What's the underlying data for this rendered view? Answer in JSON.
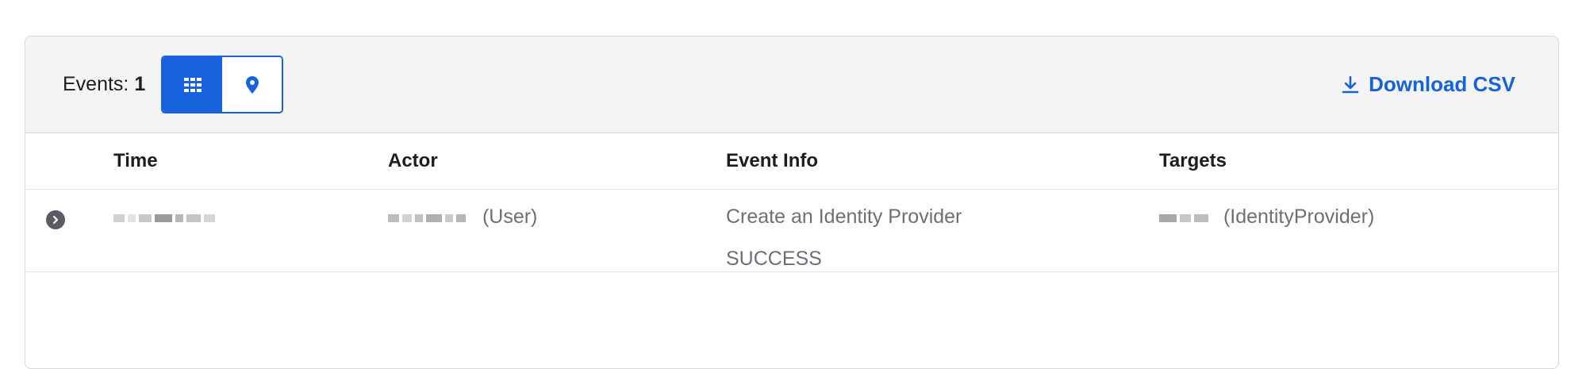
{
  "toolbar": {
    "events_label": "Events:",
    "events_count": "1",
    "view_options": [
      "grid",
      "map"
    ],
    "active_view": "grid",
    "download_label": "Download CSV"
  },
  "table": {
    "columns": [
      "Time",
      "Actor",
      "Event Info",
      "Targets"
    ],
    "rows": [
      {
        "time": "",
        "actor_type": "(User)",
        "event_name": "Create an Identity Provider",
        "event_status": "SUCCESS",
        "target_type": "(IdentityProvider)"
      }
    ]
  },
  "colors": {
    "accent": "#1662dd",
    "toolbar_bg": "#f4f4f4",
    "border": "#d7d7dc"
  },
  "icons": {
    "grid_view": "grid-icon",
    "map_view": "map-pin-icon",
    "download": "download-icon",
    "expand": "chevron-right-icon"
  }
}
